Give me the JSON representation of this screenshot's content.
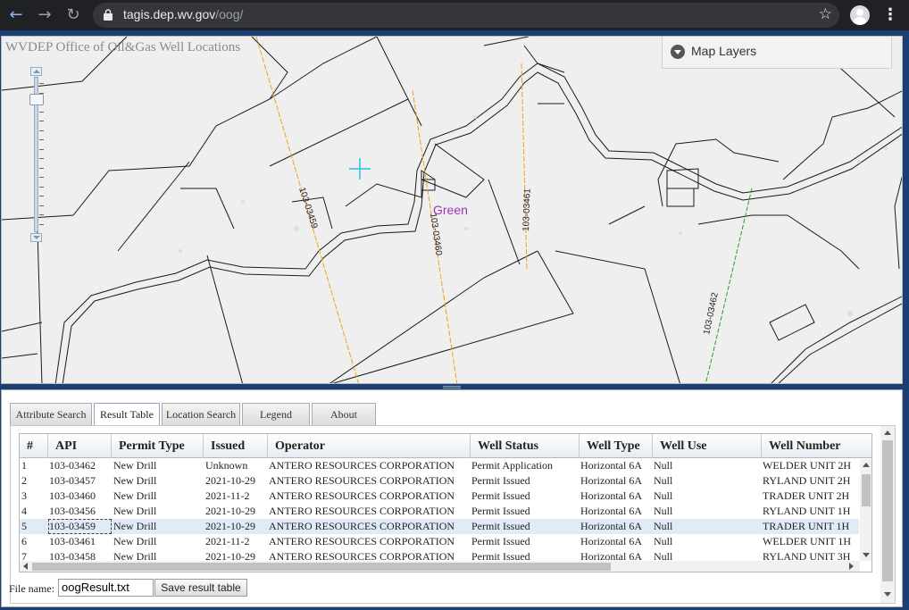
{
  "browser": {
    "url_host": "tagis.dep.wv.gov",
    "url_path": "/oog/",
    "back_icon": "arrow-left-icon",
    "forward_icon": "arrow-right-icon",
    "reload_icon": "reload-icon"
  },
  "map": {
    "title": "WVDEP Office of Oil&Gas Well Locations",
    "layers_label": "Map Layers",
    "place_label": "Green",
    "well_labels": [
      "103-03459",
      "103-03460",
      "103-03461",
      "103-03462"
    ],
    "colors": {
      "place": "#9a35b8",
      "permit_line": "#f0a020",
      "well_line": "#2a9a2a",
      "marker": "#22c4d8"
    }
  },
  "tabs": [
    {
      "label": "Attribute Search"
    },
    {
      "label": "Result Table",
      "active": true
    },
    {
      "label": "Location Search"
    },
    {
      "label": "Legend"
    },
    {
      "label": "About"
    }
  ],
  "table": {
    "columns": [
      "#",
      "API",
      "Permit Type",
      "Issued",
      "Operator",
      "Well Status",
      "Well Type",
      "Well Use",
      "Well Number"
    ],
    "rows": [
      [
        "1",
        "103-03462",
        "New Drill",
        "Unknown",
        "ANTERO RESOURCES CORPORATION",
        "Permit Application",
        "Horizontal 6A",
        "Null",
        "WELDER UNIT 2H"
      ],
      [
        "2",
        "103-03457",
        "New Drill",
        "2021-10-29",
        "ANTERO RESOURCES CORPORATION",
        "Permit Issued",
        "Horizontal 6A",
        "Null",
        "RYLAND UNIT 2H"
      ],
      [
        "3",
        "103-03460",
        "New Drill",
        "2021-11-2",
        "ANTERO RESOURCES CORPORATION",
        "Permit Issued",
        "Horizontal 6A",
        "Null",
        "TRADER UNIT 2H"
      ],
      [
        "4",
        "103-03456",
        "New Drill",
        "2021-10-29",
        "ANTERO RESOURCES CORPORATION",
        "Permit Issued",
        "Horizontal 6A",
        "Null",
        "RYLAND UNIT 1H"
      ],
      [
        "5",
        "103-03459",
        "New Drill",
        "2021-10-29",
        "ANTERO RESOURCES CORPORATION",
        "Permit Issued",
        "Horizontal 6A",
        "Null",
        "TRADER UNIT 1H"
      ],
      [
        "6",
        "103-03461",
        "New Drill",
        "2021-11-2",
        "ANTERO RESOURCES CORPORATION",
        "Permit Issued",
        "Horizontal 6A",
        "Null",
        "WELDER UNIT 1H"
      ],
      [
        "7",
        "103-03458",
        "New Drill",
        "2021-10-29",
        "ANTERO RESOURCES CORPORATION",
        "Permit Issued",
        "Horizontal 6A",
        "Null",
        "RYLAND UNIT 3H"
      ]
    ],
    "selected_row_index": 4
  },
  "footer": {
    "file_label": "File name:",
    "file_value": "oogResult.txt",
    "save_label": "Save result table"
  }
}
